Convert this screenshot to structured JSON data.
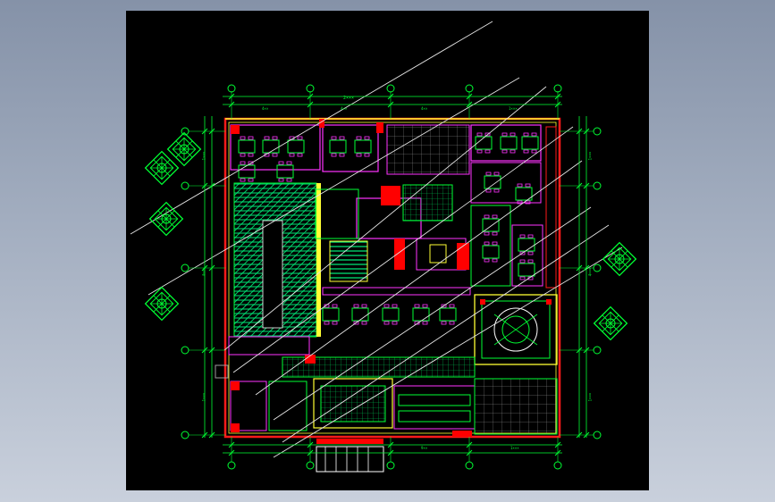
{
  "viewport": {
    "background": "#000000"
  },
  "colors": {
    "outer_wall": "#ff1a1a",
    "furniture": "#00ff33",
    "partition": "#ff33ff",
    "dimension": "#00ff33",
    "hatch": "#00cc66",
    "leader": "#e6e6e6",
    "highlight": "#ffff33",
    "light_fill": "#ff0000"
  },
  "dimensions": {
    "top_total": "2×××",
    "top_segments": [
      "4××",
      "4××",
      "4××",
      "1×××"
    ],
    "bottom_segments": [
      "9××",
      "1×××"
    ],
    "left_segments": [
      "1×××",
      "4×××",
      "1×××"
    ],
    "right_segments": [
      "1×××",
      "4×××",
      "1×××"
    ]
  },
  "icons": {
    "grid_bubble": "grid-axis-bubble-icon",
    "ornament_tile": "ornamental-tile-icon"
  }
}
